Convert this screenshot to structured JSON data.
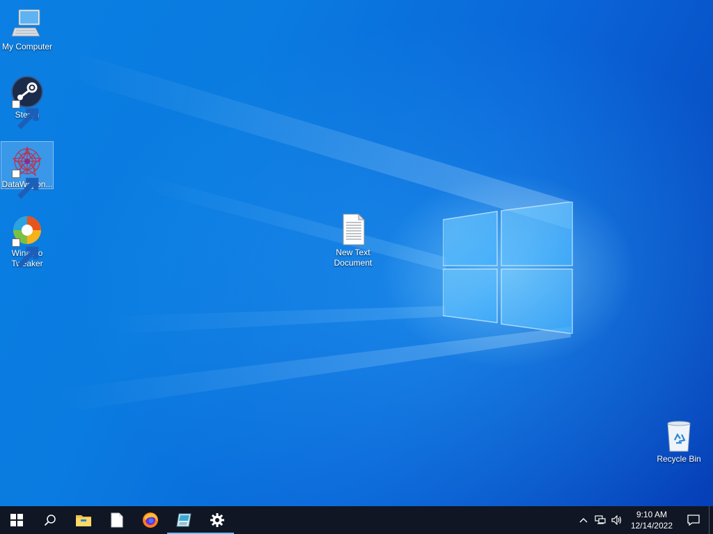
{
  "desktop": {
    "icons": [
      {
        "label": "My Computer"
      },
      {
        "label": "Steam"
      },
      {
        "label": "DataWagon..."
      },
      {
        "label": "Winaero Tweaker"
      },
      {
        "label": "New Text Document"
      },
      {
        "label": "Recycle Bin"
      }
    ],
    "selected_icon": "DataWagon..."
  },
  "taskbar": {
    "pinned": [
      {
        "icon": "windows-start-icon"
      },
      {
        "icon": "search-icon"
      },
      {
        "icon": "file-explorer-icon"
      },
      {
        "icon": "document-icon"
      },
      {
        "icon": "firefox-icon"
      },
      {
        "icon": "notepad-app-icon",
        "active": true
      },
      {
        "icon": "settings-gear-icon",
        "active": true
      }
    ],
    "tray": {
      "icons": [
        "chevron-up-icon",
        "network-icon",
        "volume-icon"
      ],
      "time": "9:10 AM",
      "date": "12/14/2022"
    }
  },
  "colors": {
    "taskbar_bg": "#101624",
    "accent": "#76b9ed",
    "wallpaper": "#0a6fdc"
  }
}
